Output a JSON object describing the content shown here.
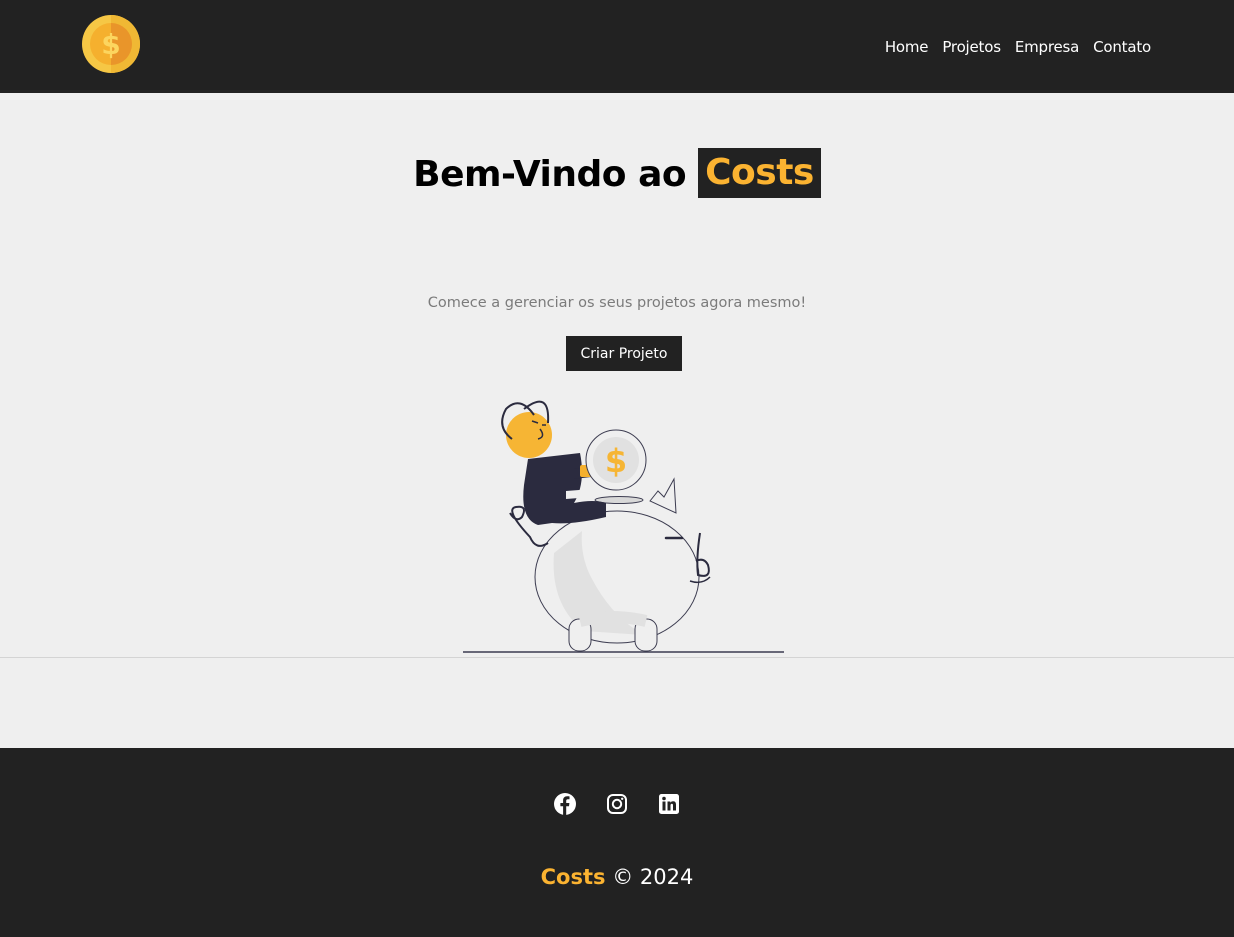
{
  "header": {
    "logo_icon": "dollar-coin-icon",
    "nav": [
      {
        "label": "Home"
      },
      {
        "label": "Projetos"
      },
      {
        "label": "Empresa"
      },
      {
        "label": "Contato"
      }
    ]
  },
  "hero": {
    "title_prefix": "Bem-Vindo ao",
    "title_brand": "Costs",
    "subtitle": "Comece a gerenciar os seus projetos agora mesmo!",
    "cta_label": "Criar Projeto",
    "illustration": "piggy-bank-savings-illustration",
    "coin_symbol": "$"
  },
  "footer": {
    "social": [
      "facebook-icon",
      "instagram-icon",
      "linkedin-icon"
    ],
    "brand": "Costs",
    "copyright": "© 2024"
  },
  "colors": {
    "dark": "#222222",
    "accent": "#fbb331",
    "background": "#efefef",
    "muted_text": "#7b7b7b"
  }
}
